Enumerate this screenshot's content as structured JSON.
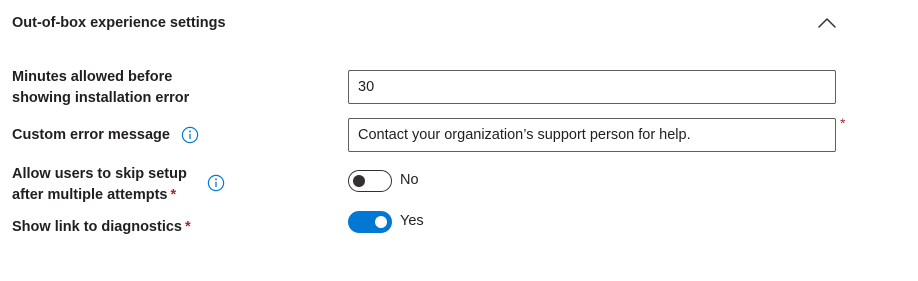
{
  "section": {
    "title": "Out-of-box experience settings",
    "collapse_icon": "chevron-up-icon"
  },
  "fields": {
    "minutes": {
      "label_line1": "Minutes allowed before",
      "label_line2": "showing installation error",
      "value": "30"
    },
    "error_message": {
      "label": "Custom error message",
      "info_icon": "info-icon",
      "value": "Contact your organization’s support person for help.",
      "required_mark": "*"
    },
    "skip_setup": {
      "label_line1": "Allow users to skip setup",
      "label_line2": "after multiple attempts",
      "required_mark": "*",
      "info_icon": "info-icon",
      "toggle_on": false,
      "state_text": "No"
    },
    "diagnostics": {
      "label": "Show link to diagnostics",
      "required_mark": "*",
      "toggle_on": true,
      "state_text": "Yes"
    }
  },
  "colors": {
    "accent": "#0078d4",
    "required": "#a4262c",
    "text": "#201f1e",
    "border": "#605e5c"
  }
}
